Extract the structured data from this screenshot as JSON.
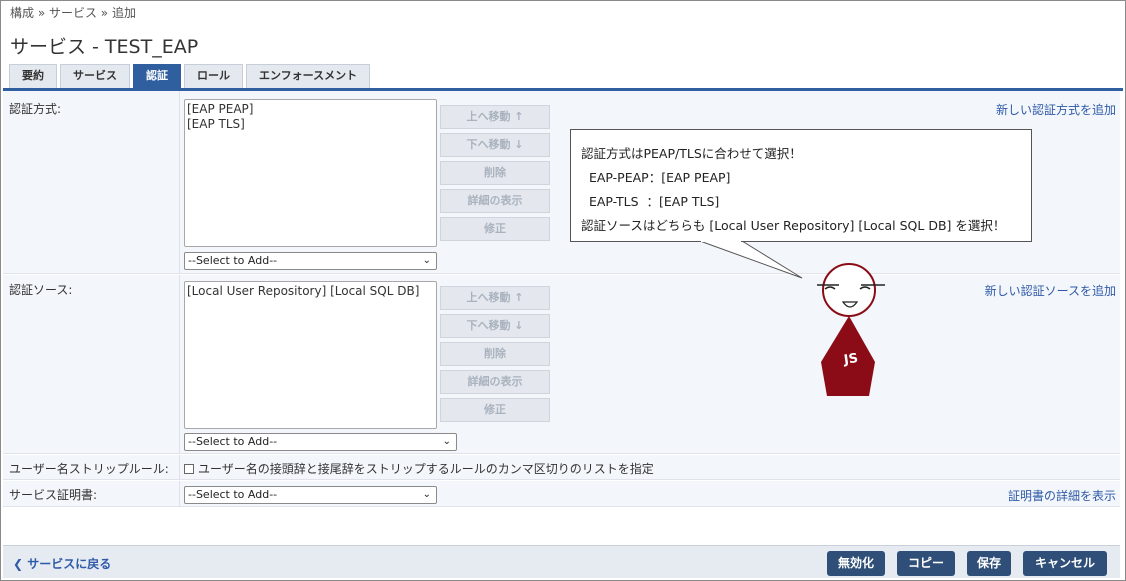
{
  "breadcrumb": "構成 » サービス » 追加",
  "page_title": "サービス - TEST_EAP",
  "tabs": [
    {
      "label": "要約"
    },
    {
      "label": "サービス"
    },
    {
      "label": "認証",
      "active": true
    },
    {
      "label": "ロール"
    },
    {
      "label": "エンフォースメント"
    }
  ],
  "auth_methods": {
    "label": "認証方式:",
    "items": [
      "[EAP PEAP]",
      "[EAP TLS]"
    ],
    "select_value": "--Select to Add--",
    "add_link": "新しい認証方式を追加"
  },
  "auth_sources": {
    "label": "認証ソース:",
    "items": [
      "[Local User Repository] [Local SQL DB]"
    ],
    "select_value": "--Select to Add--",
    "add_link": "新しい認証ソースを追加"
  },
  "list_buttons": {
    "move_up": "上へ移動 ↑",
    "move_down": "下へ移動 ↓",
    "delete": "削除",
    "details": "詳細の表示",
    "edit": "修正"
  },
  "strip_rule": {
    "label": "ユーザー名ストリップルール:",
    "checkbox_text": "ユーザー名の接頭辞と接尾辞をストリップするルールのカンマ区切りのリストを指定"
  },
  "service_cert": {
    "label": "サービス証明書:",
    "select_value": "--Select to Add--",
    "details_link": "証明書の詳細を表示"
  },
  "footer": {
    "back": "サービスに戻る",
    "disable": "無効化",
    "copy": "コピー",
    "save": "保存",
    "cancel": "キャンセル"
  },
  "callout": {
    "line1": "認証方式はPEAP/TLSに合わせて選択！",
    "line2": "  EAP-PEAP：[EAP PEAP]",
    "line3": "  EAP-TLS  ：[EAP TLS]",
    "line4": "認証ソースはどちらも [Local User Repository] [Local SQL DB] を選択！"
  },
  "mascot": {
    "badge": "JS"
  },
  "colors": {
    "accent": "#2f5f9e",
    "footer_button": "#2f4f78",
    "link": "#2e5aa8",
    "mascot": "#8b0c17"
  }
}
